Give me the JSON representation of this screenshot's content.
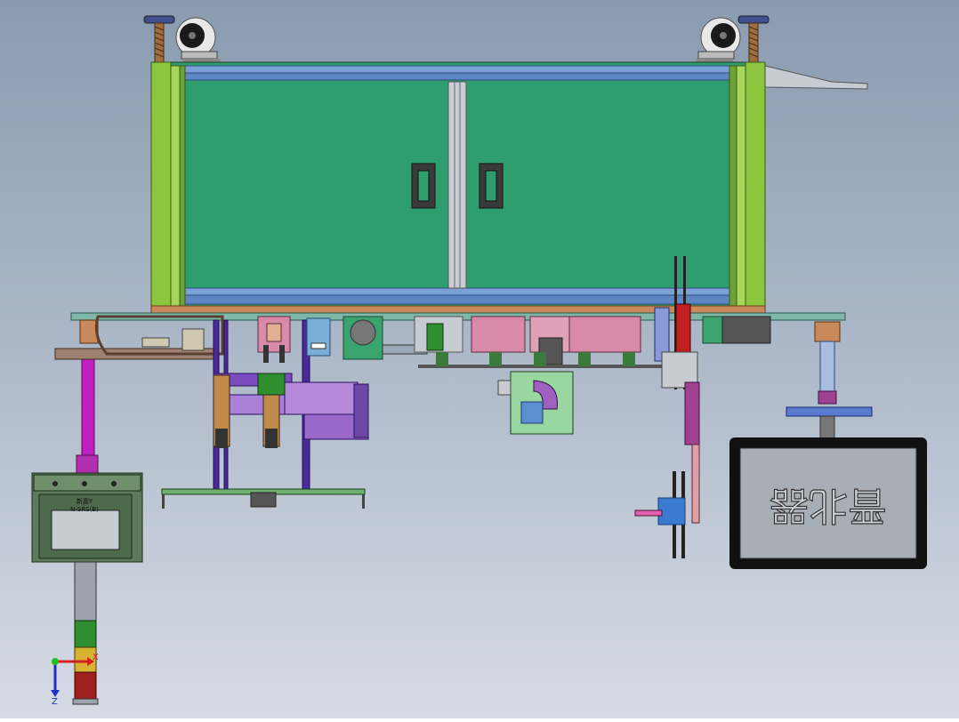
{
  "drawing": {
    "controller_label_1": "新嘉Y",
    "controller_label_2": "N-SRS(B)",
    "signage_text": "晋北器",
    "triad": {
      "x": "X",
      "y": "Y",
      "z": "Z"
    }
  },
  "colors": {
    "cabinet_door": "#2e9e6e",
    "frame_green": "#8cc63f",
    "steel_blue": "#4a6fb0",
    "magenta": "#c040b0",
    "purple": "#7a4bbd",
    "copper": "#c9895a",
    "pink": "#d98aa8",
    "monitor_bezel": "#111111",
    "monitor_screen": "#a8aeb6",
    "stack_green": "#2f8f2f",
    "stack_yellow": "#d6b432",
    "stack_red": "#a02020"
  },
  "icons": [
    "caster-wheel-icon",
    "leveling-foot-icon",
    "door-handle-icon",
    "axis-triad-icon"
  ]
}
